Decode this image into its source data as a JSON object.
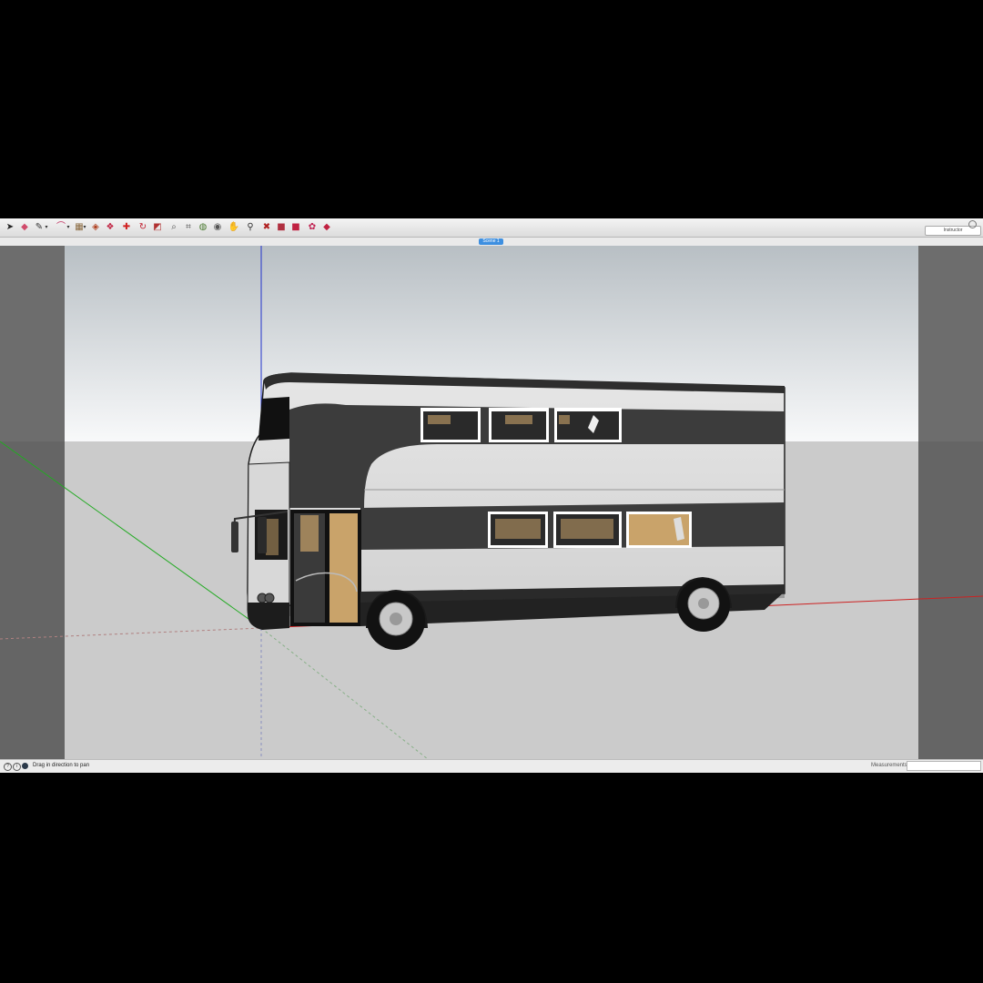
{
  "toolbar": {
    "tools": [
      {
        "name": "select-tool-icon",
        "glyph": "➤",
        "color": "#222222"
      },
      {
        "name": "eraser-tool-icon",
        "glyph": "◆",
        "color": "#d04a6a"
      },
      {
        "name": "line-tool-icon",
        "glyph": "✎",
        "color": "#333333"
      },
      {
        "name": "line-dropdown-icon",
        "glyph": "▾",
        "color": "#333333"
      },
      {
        "name": "arc-tool-icon",
        "glyph": "⌒",
        "color": "#c03060"
      },
      {
        "name": "arc-dropdown-icon",
        "glyph": "▾",
        "color": "#333333"
      },
      {
        "name": "shape-tool-icon",
        "glyph": "▦",
        "color": "#8a6a40"
      },
      {
        "name": "shape-dropdown-icon",
        "glyph": "▾",
        "color": "#333333"
      },
      {
        "name": "push-pull-tool-icon",
        "glyph": "◈",
        "color": "#b04020"
      },
      {
        "name": "offset-tool-icon",
        "glyph": "❖",
        "color": "#c02040"
      },
      {
        "name": "move-tool-icon",
        "glyph": "✚",
        "color": "#d02020"
      },
      {
        "name": "rotate-tool-icon",
        "glyph": "↻",
        "color": "#c02030"
      },
      {
        "name": "scale-tool-icon",
        "glyph": "◩",
        "color": "#b03030"
      },
      {
        "name": "tape-measure-tool-icon",
        "glyph": "⌕",
        "color": "#555555"
      },
      {
        "name": "text-tool-icon",
        "glyph": "⌗",
        "color": "#555555"
      },
      {
        "name": "paint-bucket-tool-icon",
        "glyph": "◍",
        "color": "#4a7a30"
      },
      {
        "name": "orbit-tool-icon",
        "glyph": "◉",
        "color": "#555555"
      },
      {
        "name": "pan-tool-icon",
        "glyph": "✋",
        "color": "#8a7040"
      },
      {
        "name": "zoom-tool-icon",
        "glyph": "⚲",
        "color": "#333333"
      },
      {
        "name": "zoom-extents-tool-icon",
        "glyph": "✖",
        "color": "#b02020"
      },
      {
        "name": "warehouse-icon",
        "glyph": "■",
        "color": "#b03040"
      },
      {
        "name": "extension-warehouse-icon",
        "glyph": "■",
        "color": "#c02040"
      },
      {
        "name": "layout-icon",
        "glyph": "✿",
        "color": "#c02050"
      },
      {
        "name": "styles-icon",
        "glyph": "◆",
        "color": "#c02040"
      }
    ],
    "search_text": "Instructor"
  },
  "scene_bar": {
    "active_tab": "Scene 1"
  },
  "status_bar": {
    "hint": "Drag in direction to pan",
    "measurements_label": "Measurements"
  },
  "colors": {
    "sky_top": "#b8bfc4",
    "sky_bottom": "#f8f9fa",
    "ground": "#cbcbcb",
    "bus_body": "#dcdcdc",
    "bus_stripe": "#3c3c3c",
    "interior": "#c9a36a",
    "axis_red": "#cc2222",
    "axis_green": "#22aa22",
    "axis_blue": "#2233cc"
  }
}
